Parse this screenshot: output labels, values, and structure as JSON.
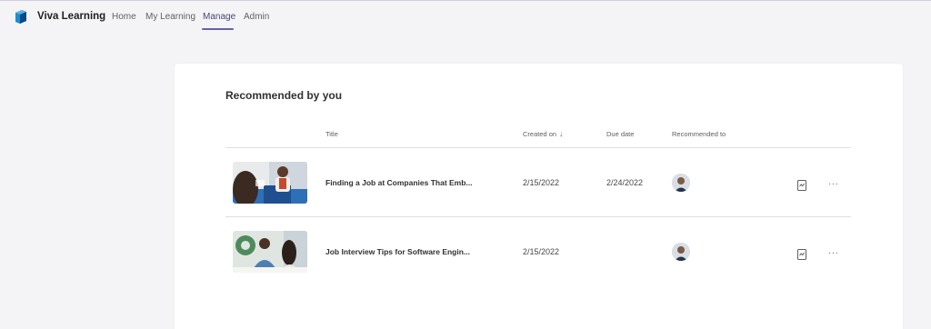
{
  "app": {
    "name": "Viva Learning",
    "logo": "viva-learning-logo"
  },
  "nav": {
    "items": [
      {
        "label": "Home"
      },
      {
        "label": "My Learning"
      },
      {
        "label": "Manage",
        "active": true
      },
      {
        "label": "Admin"
      }
    ]
  },
  "section": {
    "title": "Recommended by you"
  },
  "table": {
    "columns": {
      "title": "Title",
      "created_on": "Created on",
      "created_on_sort": "↓",
      "due_date": "Due date",
      "recommended_to": "Recommended to"
    },
    "rows": [
      {
        "title": "Finding a Job at Companies That Emb...",
        "created_on": "2/15/2022",
        "due_date": "2/24/2022",
        "recommended_to": "user-avatar",
        "action_icon": "progress-report-icon",
        "more": "···"
      },
      {
        "title": "Job Interview Tips for Software Engin...",
        "created_on": "2/15/2022",
        "due_date": "",
        "recommended_to": "user-avatar",
        "action_icon": "progress-report-icon",
        "more": "···"
      }
    ]
  },
  "colors": {
    "accent": "#6264a7",
    "background": "#f4f4f6",
    "card": "#ffffff"
  }
}
